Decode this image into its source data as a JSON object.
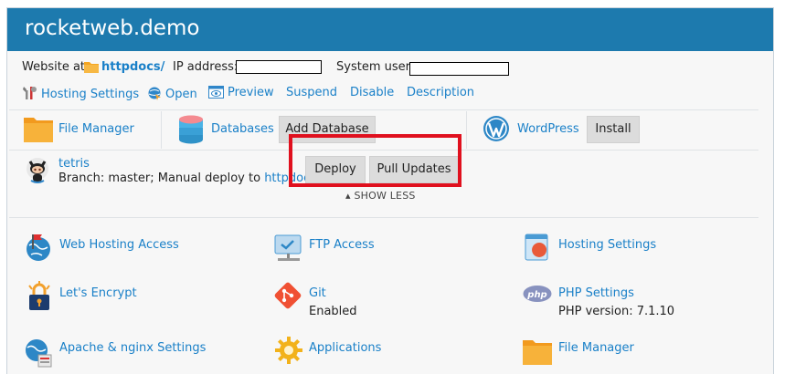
{
  "header": {
    "title": "rocketweb.demo"
  },
  "info": {
    "website_at_label": "Website at",
    "website_folder": "httpdocs/",
    "ip_label": "IP address:",
    "user_label": "System user:"
  },
  "actions": {
    "hosting_settings": "Hosting Settings",
    "open": "Open",
    "preview": "Preview",
    "suspend": "Suspend",
    "disable": "Disable",
    "description": "Description"
  },
  "quick": {
    "file_manager": "File Manager",
    "databases": "Databases",
    "add_database": "Add Database",
    "wordpress": "WordPress",
    "install": "Install"
  },
  "git_repo": {
    "name": "tetris",
    "branch_text": "Branch: master; Manual deploy to",
    "deploy_target": "httpdocs",
    "deploy_button": "Deploy",
    "pull_button": "Pull Updates"
  },
  "show_less": "SHOW LESS",
  "tools": {
    "web_hosting_access": "Web Hosting Access",
    "ftp_access": "FTP Access",
    "hosting_settings": "Hosting Settings",
    "lets_encrypt": "Let's Encrypt",
    "git": "Git",
    "git_status": "Enabled",
    "php_settings": "PHP Settings",
    "php_version": "PHP version: 7.1.10",
    "apache_nginx": "Apache & nginx Settings",
    "applications": "Applications",
    "file_manager": "File Manager"
  },
  "colors": {
    "header_bg": "#1d7aae",
    "link": "#1a80c8",
    "highlight": "#e0101e",
    "folder": "#f5a623"
  },
  "icons": {
    "tools_icon": "wrench-icon",
    "open_icon": "open-globe-icon",
    "preview_icon": "preview-eye-icon",
    "folder_icon": "folder-icon",
    "db_icon": "database-icon",
    "wp_icon": "wordpress-icon",
    "git_icon": "github-octocat-icon"
  }
}
